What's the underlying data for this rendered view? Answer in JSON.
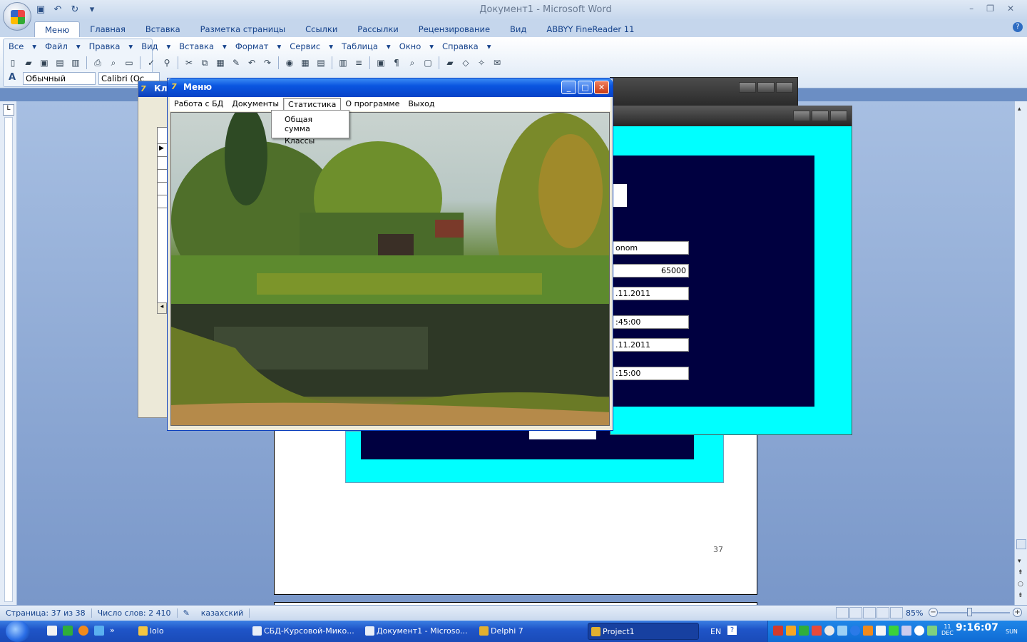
{
  "word": {
    "title": "Документ1 - Microsoft Word",
    "ribbon_tabs": [
      "Меню",
      "Главная",
      "Вставка",
      "Разметка страницы",
      "Ссылки",
      "Рассылки",
      "Рецензирование",
      "Вид",
      "ABBYY FineReader 11"
    ],
    "classic_menu": [
      "Все",
      "Файл",
      "Правка",
      "Вид",
      "Вставка",
      "Формат",
      "Сервис",
      "Таблица",
      "Окно",
      "Справка"
    ],
    "style_value": "Обычный",
    "font_value": "Calibri (Ос",
    "page_number": "37",
    "status": {
      "page": "Страница: 37 из 38",
      "words": "Число слов: 2 410",
      "language": "казахский",
      "zoom": "85%"
    }
  },
  "win_back": {
    "title": "Кл"
  },
  "win_menu": {
    "title": "Меню",
    "menu": [
      "Работа с БД",
      "Документы",
      "Статистика",
      "О программе",
      "Выход"
    ],
    "dropdown": [
      "Общая сумма",
      "Классы"
    ]
  },
  "win_form": {
    "fields": [
      "onom",
      "65000",
      ".11.2011",
      ":45:00",
      ".11.2011",
      ":15:00"
    ]
  },
  "taskbar": {
    "quick": "lolo",
    "tasks": [
      "СБД-Курсовой-Мико...",
      "Документ1 - Microso...",
      "Delphi 7",
      "Project1"
    ],
    "lang": "EN",
    "time": "9:16:07",
    "date_day": "11",
    "date_month": "DEC",
    "weekday": "SUN"
  },
  "colors": {
    "cyan": "#00ffff",
    "navy": "#000040",
    "xp_blue": "#0a55e0"
  }
}
